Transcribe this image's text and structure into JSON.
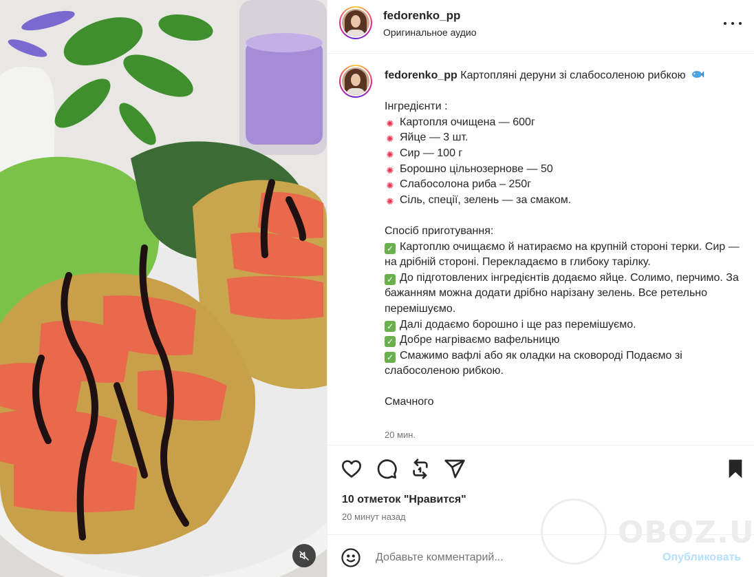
{
  "header": {
    "username": "fedorenko_pp",
    "subtitle": "Оригинальное аудио"
  },
  "caption": {
    "username": "fedorenko_pp",
    "title": "Картопляні деруни зі слабосоленою рибкою",
    "title_emoji": "fish-emoji",
    "ingredients_heading": "Інгредієнти :",
    "ingredients": [
      "Картопля очищена — 600г",
      "Яйце — 3 шт.",
      "Сир — 100 г",
      "Борошно цільнозернове — 50",
      "Слабосолона риба – 250г",
      "Сіль, спеції, зелень — за смаком."
    ],
    "method_heading": "Спосіб приготування:",
    "steps": [
      "Картоплю очищаємо й натираємо на крупній стороні терки. Сир — на дрібній стороні. Перекладаємо в глибоку тарілку.",
      "До підготовлених інгредієнтів додаємо яйце. Солимо, перчимо. За бажанням можна додати дрібно нарізану зелень. Все ретельно перемішуємо.",
      "Далі додаємо борошно і ще раз перемішуємо.",
      "Добре нагріваємо вафельницю",
      "Смажимо вафлі або як оладки на сковороді Подаємо зі слабосоленою рибкою."
    ],
    "closing": "Смачного",
    "time": "20 мин."
  },
  "actions": {
    "likes": "10 отметок \"Нравится\"",
    "posted": "20 минут назад"
  },
  "comment": {
    "placeholder": "Добавьте комментарий...",
    "publish": "Опубликовать"
  },
  "watermark": "OBOZ.UA",
  "colors": {
    "accent_blue": "#b2dffc",
    "text": "#262626",
    "muted": "#737373",
    "bullet_red": "#e8334f",
    "check_green": "#6ab04c"
  }
}
